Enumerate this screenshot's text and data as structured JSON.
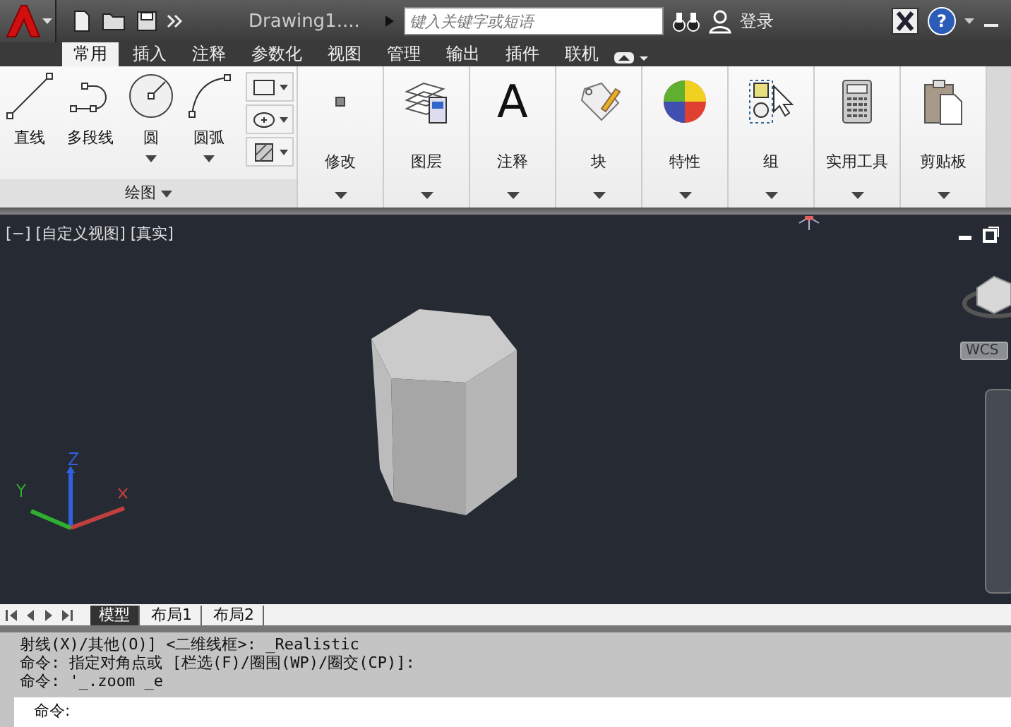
{
  "title_bar": {
    "document_title": "Drawing1....",
    "search": {
      "placeholder": "键入关键字或短语"
    },
    "login": "登录",
    "help": "?"
  },
  "tabs": [
    {
      "label": "常用",
      "selected": true
    },
    {
      "label": "插入",
      "selected": false
    },
    {
      "label": "注释",
      "selected": false
    },
    {
      "label": "参数化",
      "selected": false
    },
    {
      "label": "视图",
      "selected": false
    },
    {
      "label": "管理",
      "selected": false
    },
    {
      "label": "输出",
      "selected": false
    },
    {
      "label": "插件",
      "selected": false
    },
    {
      "label": "联机",
      "selected": false
    }
  ],
  "draw_panel": {
    "title": "绘图",
    "tools": [
      {
        "kind": "line",
        "label": "直线",
        "dropdown": false
      },
      {
        "kind": "polyline",
        "label": "多段线",
        "dropdown": false
      },
      {
        "kind": "circle",
        "label": "圆",
        "dropdown": true
      },
      {
        "kind": "arc",
        "label": "圆弧",
        "dropdown": true
      }
    ],
    "small_tools": [
      {
        "kind": "rectangle"
      },
      {
        "kind": "ellipse"
      },
      {
        "kind": "hatch"
      }
    ]
  },
  "panels": [
    {
      "kind": "modify",
      "label": "修改"
    },
    {
      "kind": "layer",
      "label": "图层"
    },
    {
      "kind": "annotate",
      "label": "注释",
      "icon_text": "A"
    },
    {
      "kind": "block",
      "label": "块"
    },
    {
      "kind": "properties",
      "label": "特性"
    },
    {
      "kind": "group",
      "label": "组"
    },
    {
      "kind": "utilities",
      "label": "实用工具"
    },
    {
      "kind": "clipboard",
      "label": "剪贴板"
    }
  ],
  "viewport": {
    "controls": "[−] [自定义视图] [真实]",
    "wcs": "WCS"
  },
  "layout_tabs": [
    {
      "label": "模型",
      "selected": true
    },
    {
      "label": "布局1",
      "selected": false
    },
    {
      "label": "布局2",
      "selected": false
    }
  ],
  "command_history": [
    "射线(X)/其他(O)] <二维线框>: _Realistic",
    "命令: 指定对角点或 [栏选(F)/圈围(WP)/圈交(CP)]:",
    "命令: '_.zoom _e"
  ],
  "command_prompt": "命令:"
}
